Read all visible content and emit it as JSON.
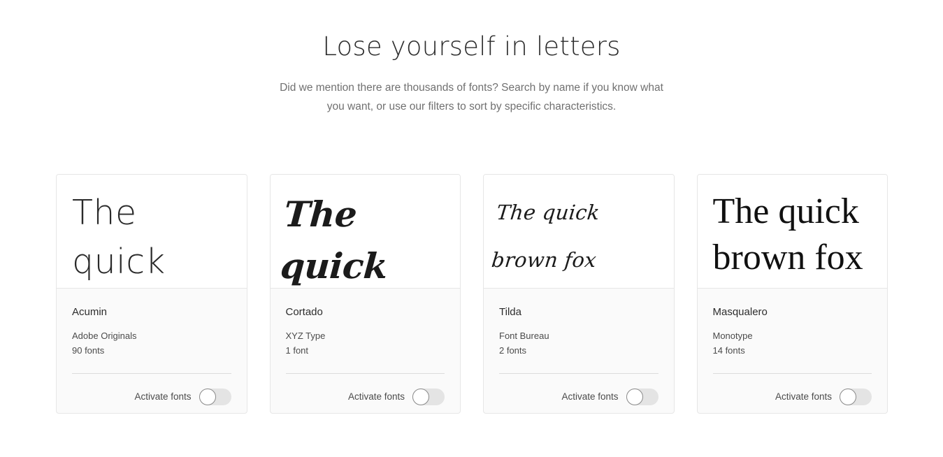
{
  "header": {
    "title": "Lose yourself in letters",
    "subtitle": "Did we mention there are thousands of fonts? Search by name if you know what you want, or use our filters to sort by specific characteristics."
  },
  "colors": {
    "page_background": "#ffffff",
    "title_text": "#2c2c2c",
    "subtitle_text": "#707070",
    "card_background": "#fafafa",
    "card_preview_background": "#ffffff",
    "card_border": "#e6e6e6",
    "rule": "#dcdcdc",
    "toggle_track_off": "#e4e4e4",
    "toggle_knob": "#ffffff",
    "toggle_knob_border": "#8a8a8a",
    "accent": "#1473e6"
  },
  "cards": [
    {
      "preview_text": "The quick brown fox",
      "name": "Acumin",
      "foundry": "Adobe Originals",
      "font_count": "90 fonts",
      "activate_label": "Activate fonts",
      "activated": false
    },
    {
      "preview_text": "The quick brown fox jumps",
      "name": "Cortado",
      "foundry": "XYZ Type",
      "font_count": "1 font",
      "activate_label": "Activate fonts",
      "activated": false
    },
    {
      "preview_text": "The quick brown fox jumps over the lazy",
      "name": "Tilda",
      "foundry": "Font Bureau",
      "font_count": "2 fonts",
      "activate_label": "Activate fonts",
      "activated": false
    },
    {
      "preview_text": "The quick brown fox",
      "name": "Masqualero",
      "foundry": "Monotype",
      "font_count": "14 fonts",
      "activate_label": "Activate fonts",
      "activated": false
    }
  ]
}
